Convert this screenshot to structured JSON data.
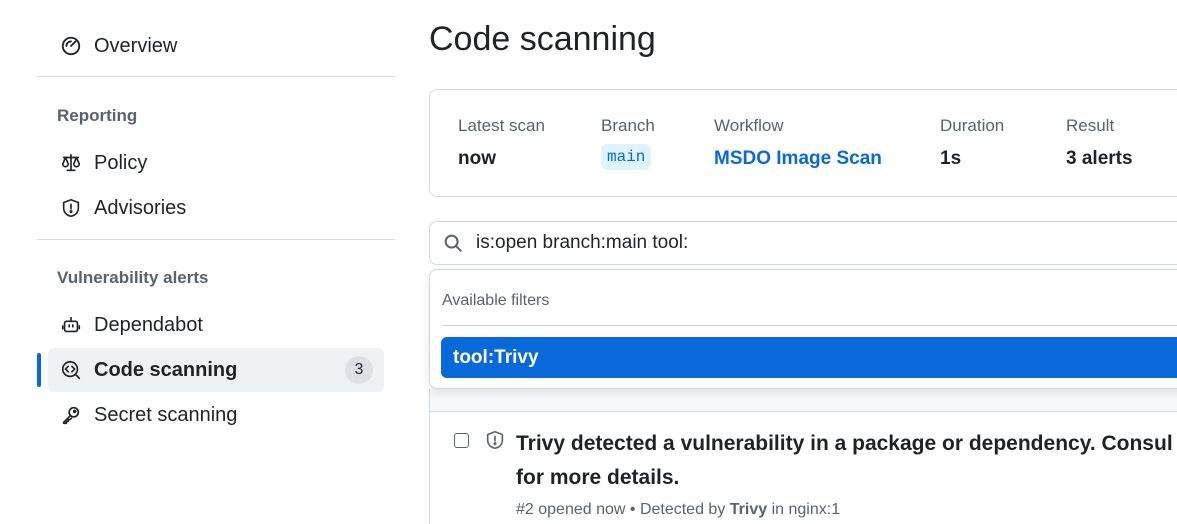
{
  "sidebar": {
    "overview": {
      "label": "Overview",
      "icon": "meter-icon"
    },
    "reporting": {
      "heading": "Reporting",
      "items": [
        {
          "label": "Policy",
          "icon": "law-icon"
        },
        {
          "label": "Advisories",
          "icon": "shield-icon"
        }
      ]
    },
    "vulnerability_alerts": {
      "heading": "Vulnerability alerts",
      "items": [
        {
          "label": "Dependabot",
          "icon": "dependabot-icon"
        },
        {
          "label": "Code scanning",
          "icon": "codescan-icon",
          "count": "3",
          "active": true
        },
        {
          "label": "Secret scanning",
          "icon": "key-icon"
        }
      ]
    }
  },
  "main": {
    "title": "Code scanning",
    "scan_summary": {
      "latest_scan": {
        "label": "Latest scan",
        "value": "now"
      },
      "branch": {
        "label": "Branch",
        "value": "main"
      },
      "workflow": {
        "label": "Workflow",
        "value": "MSDO Image Scan"
      },
      "duration": {
        "label": "Duration",
        "value": "1s"
      },
      "result": {
        "label": "Result",
        "value": "3 alerts"
      }
    },
    "search": {
      "query": "is:open branch:main tool:",
      "icon": "search-icon"
    },
    "filter_dropdown": {
      "heading": "Available filters",
      "options": [
        {
          "label": "tool:Trivy",
          "selected": true
        }
      ]
    },
    "alerts": [
      {
        "title": "Trivy detected a vulnerability in a package or dependency. Consul for more details.",
        "number": "#2",
        "opened": "opened now",
        "detected_by_prefix": "• Detected by",
        "tool": "Trivy",
        "in_text": "in nginx:1"
      }
    ]
  },
  "colors": {
    "accent": "#0969da",
    "active_bg": "#eff1f3",
    "muted": "#59636e"
  }
}
